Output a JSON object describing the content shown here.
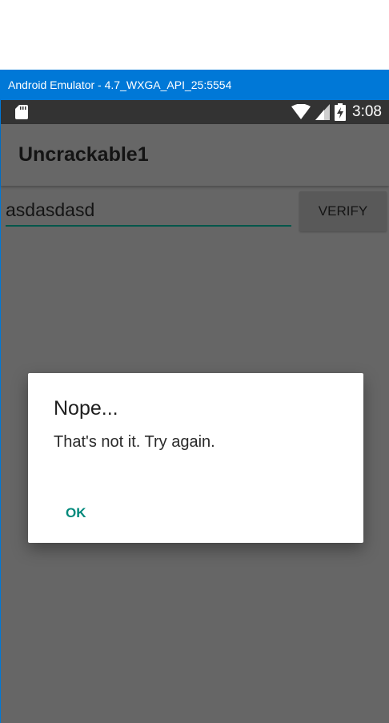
{
  "window": {
    "title": "Android Emulator - 4.7_WXGA_API_25:5554"
  },
  "statusbar": {
    "time": "3:08",
    "icons": [
      "sd-card-icon",
      "wifi-icon",
      "cell-signal-icon",
      "battery-charging-icon"
    ]
  },
  "app": {
    "title": "Uncrackable1"
  },
  "form": {
    "input_value": "asdasdasd",
    "verify_label": "VERIFY"
  },
  "dialog": {
    "title": "Nope...",
    "message": "That's not it. Try again.",
    "ok_label": "OK"
  },
  "colors": {
    "titlebar": "#0078d7",
    "statusbar": "#333333",
    "scrim_background": "#666666",
    "input_underline": "#00574b",
    "accent": "#00897b"
  }
}
